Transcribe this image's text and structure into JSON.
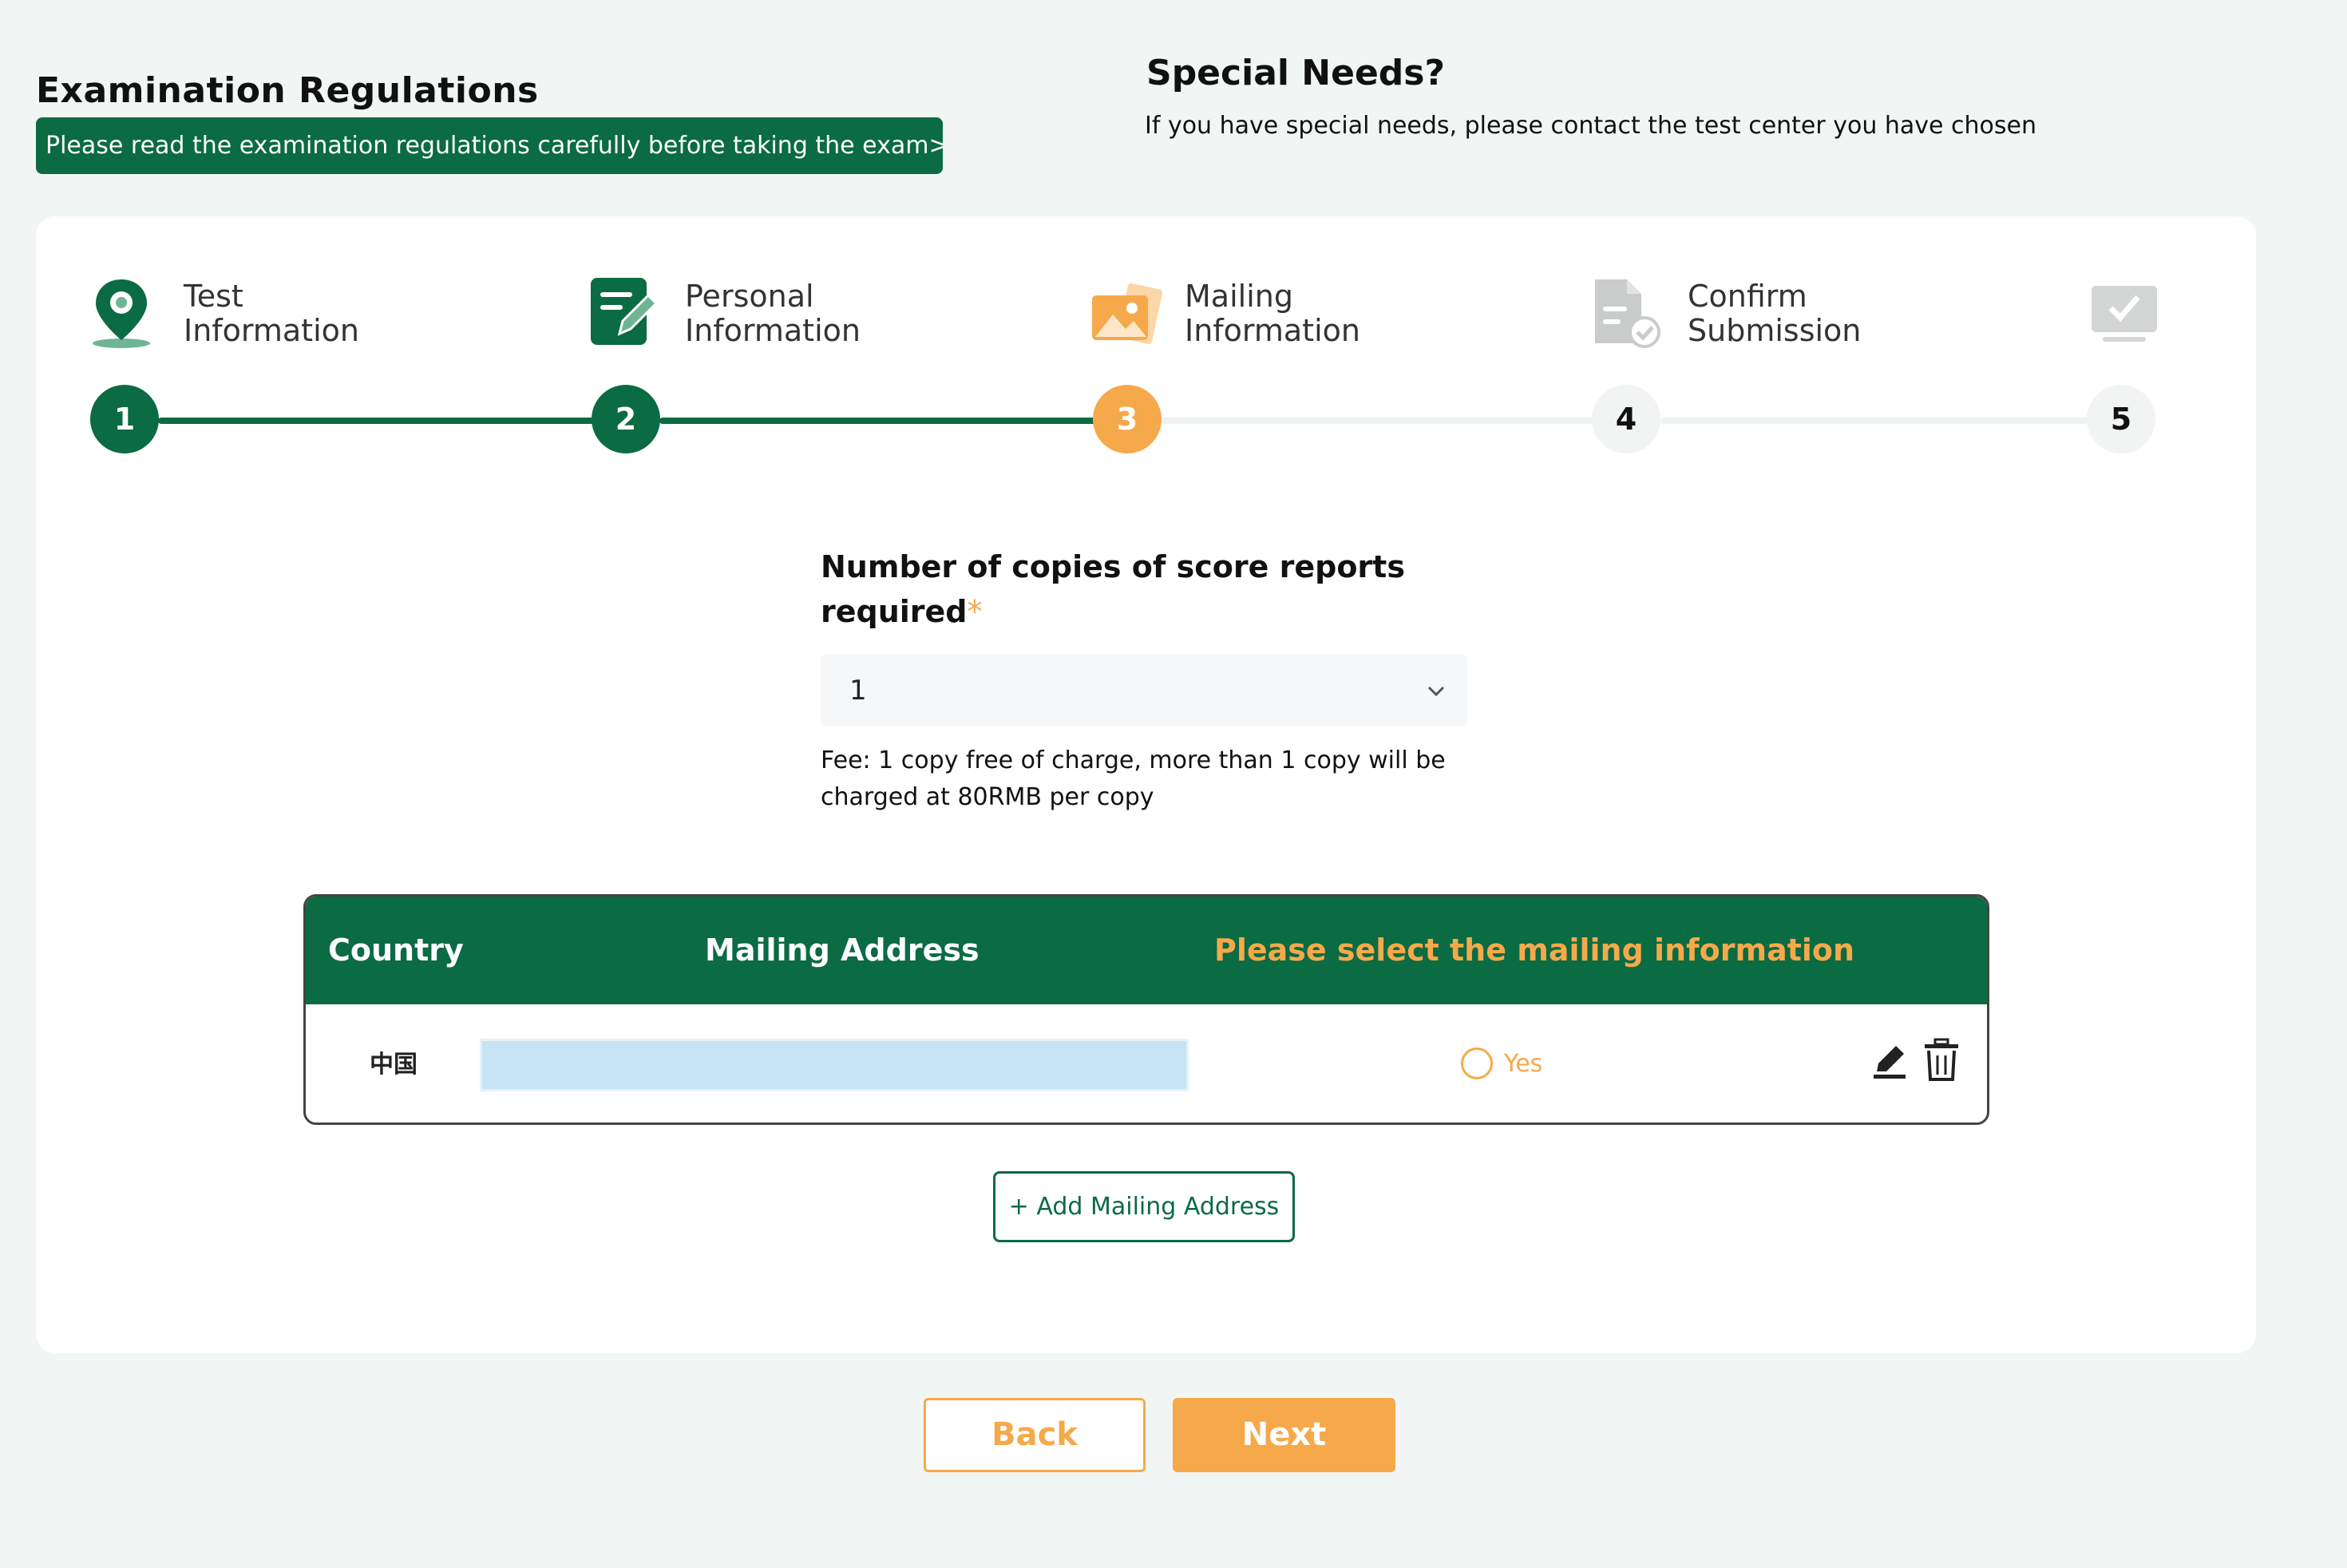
{
  "regulations": {
    "title": "Examination Regulations",
    "banner_link": "Please read the examination regulations carefully before taking the exam>"
  },
  "special_needs": {
    "title": "Special Needs?",
    "text": "If you have special needs, please contact the test center you have chosen"
  },
  "stepper": {
    "current_step": 3,
    "steps": [
      {
        "number": "1",
        "label_line1": "Test",
        "label_line2": "Information",
        "status": "done",
        "icon": "map-pin-icon"
      },
      {
        "number": "2",
        "label_line1": "Personal",
        "label_line2": "Information",
        "status": "done",
        "icon": "edit-document-icon"
      },
      {
        "number": "3",
        "label_line1": "Mailing",
        "label_line2": "Information",
        "status": "active",
        "icon": "image-mail-icon"
      },
      {
        "number": "4",
        "label_line1": "Confirm",
        "label_line2": "Submission",
        "status": "todo",
        "icon": "document-check-icon"
      },
      {
        "number": "5",
        "label_line1": "",
        "label_line2": "",
        "status": "todo",
        "icon": "monitor-check-icon"
      }
    ]
  },
  "copies": {
    "label": "Number of copies of score reports required",
    "required_mark": "*",
    "selected_value": "1",
    "fee_note": "Fee:  1 copy free of charge, more than  1 copy will be charged at 80RMB per copy"
  },
  "mailing_table": {
    "headers": {
      "country": "Country",
      "address": "Mailing Address",
      "select": "Please select the mailing information"
    },
    "rows": [
      {
        "country": "中国",
        "address": "",
        "radio_label": "Yes",
        "selected": false
      }
    ]
  },
  "add_address_label": "+ Add Mailing Address",
  "buttons": {
    "back": "Back",
    "next": "Next"
  },
  "colors": {
    "primary_green": "#0b6b43",
    "accent_orange": "#f6a94a",
    "page_background": "#f1f6f4",
    "address_highlight": "#c5e4f4"
  }
}
